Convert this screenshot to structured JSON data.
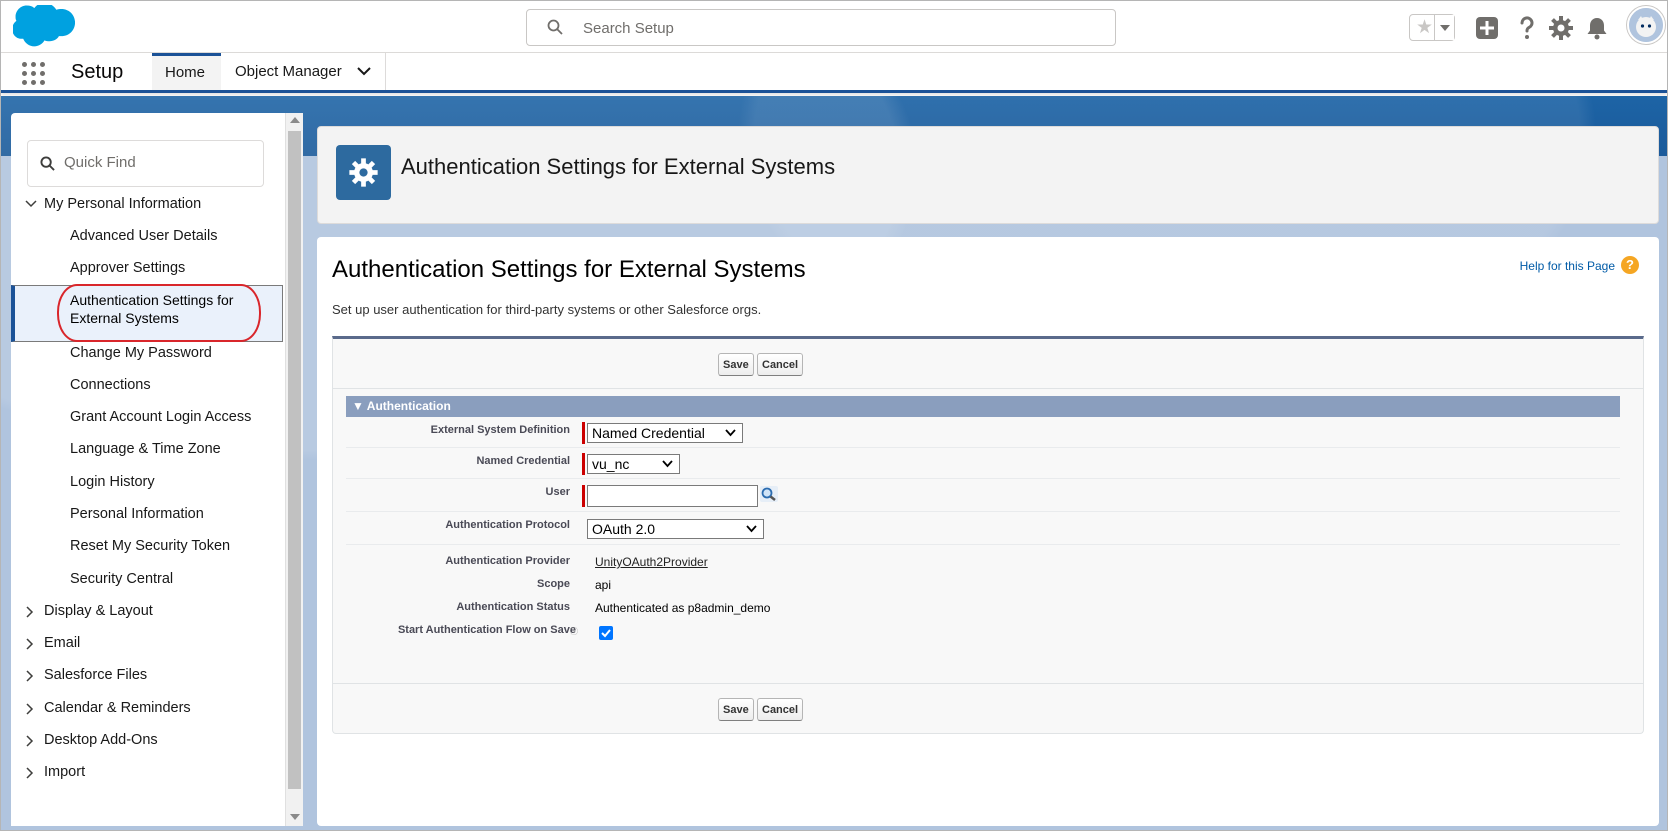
{
  "header": {
    "search_placeholder": "Search Setup"
  },
  "appnav": {
    "title": "Setup",
    "tabs": [
      {
        "label": "Home"
      },
      {
        "label": "Object Manager"
      }
    ]
  },
  "sidebar": {
    "quick_find_placeholder": "Quick Find",
    "items": [
      {
        "label": "My Personal Information",
        "expanded": true
      },
      {
        "label": "Advanced User Details"
      },
      {
        "label": "Approver Settings"
      },
      {
        "label": "Authentication Settings for External Systems",
        "selected": true
      },
      {
        "label": "Change My Password"
      },
      {
        "label": "Connections"
      },
      {
        "label": "Grant Account Login Access"
      },
      {
        "label": "Language & Time Zone"
      },
      {
        "label": "Login History"
      },
      {
        "label": "Personal Information"
      },
      {
        "label": "Reset My Security Token"
      },
      {
        "label": "Security Central"
      },
      {
        "label": "Display & Layout",
        "expanded": false
      },
      {
        "label": "Email",
        "expanded": false
      },
      {
        "label": "Salesforce Files",
        "expanded": false
      },
      {
        "label": "Calendar & Reminders",
        "expanded": false
      },
      {
        "label": "Desktop Add-Ons",
        "expanded": false
      },
      {
        "label": "Import",
        "expanded": false
      }
    ]
  },
  "page_header": {
    "title": "Authentication Settings for External Systems",
    "icon": "gear-icon"
  },
  "main": {
    "title": "Authentication Settings for External Systems",
    "help_link": "Help for this Page",
    "description": "Set up user authentication for third-party systems or other Salesforce orgs.",
    "save_label": "Save",
    "cancel_label": "Cancel",
    "section_title": "Authentication",
    "fields": {
      "external_system_definition": {
        "label": "External System Definition",
        "value": "Named Credential"
      },
      "named_credential": {
        "label": "Named Credential",
        "value": "vu_nc"
      },
      "user": {
        "label": "User",
        "value": ""
      },
      "authentication_protocol": {
        "label": "Authentication Protocol",
        "value": "OAuth 2.0"
      },
      "authentication_provider": {
        "label": "Authentication Provider",
        "value": "UnityOAuth2Provider"
      },
      "scope": {
        "label": "Scope",
        "value": "api"
      },
      "authentication_status": {
        "label": "Authentication Status",
        "value": "Authenticated as p8admin_demo"
      },
      "start_flow": {
        "label": "Start Authentication Flow on Save",
        "checked": true
      }
    }
  },
  "colors": {
    "brand": "#00a1e0",
    "nav_accent": "#1b5297",
    "section_bar": "#8a9ebe",
    "required": "#cc0000",
    "highlight_oval": "#d9262b"
  }
}
